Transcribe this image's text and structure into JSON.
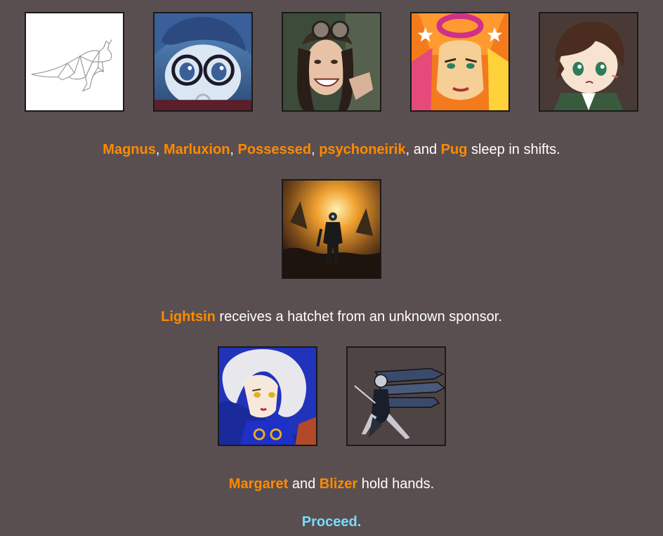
{
  "event1": {
    "tributes": [
      {
        "name": "Magnus",
        "avatar_icon": "kangaroo-sketch-icon"
      },
      {
        "name": "Marluxion",
        "avatar_icon": "glasses-boy-icon"
      },
      {
        "name": "Possessed",
        "avatar_icon": "goggles-woman-icon"
      },
      {
        "name": "psychoneirik",
        "avatar_icon": "orange-hair-girl-icon"
      },
      {
        "name": "Pug",
        "avatar_icon": "chibi-boy-icon"
      }
    ],
    "sep_comma": ", ",
    "sep_and": ", and ",
    "action": " sleep in shifts."
  },
  "event2": {
    "tributes": [
      {
        "name": "Lightsin",
        "avatar_icon": "soldier-explosion-icon"
      }
    ],
    "action": " receives a hatchet from an unknown sponsor."
  },
  "event3": {
    "tributes": [
      {
        "name": "Margaret",
        "avatar_icon": "white-hair-woman-icon"
      },
      {
        "name": "Blizer",
        "avatar_icon": "robot-android-icon"
      }
    ],
    "sep_and": " and ",
    "action": " hold hands."
  },
  "proceed_label": "Proceed.",
  "colors": {
    "background": "#5a4f50",
    "name": "#ff8a00",
    "link": "#77ddff",
    "text": "#ffffff"
  }
}
